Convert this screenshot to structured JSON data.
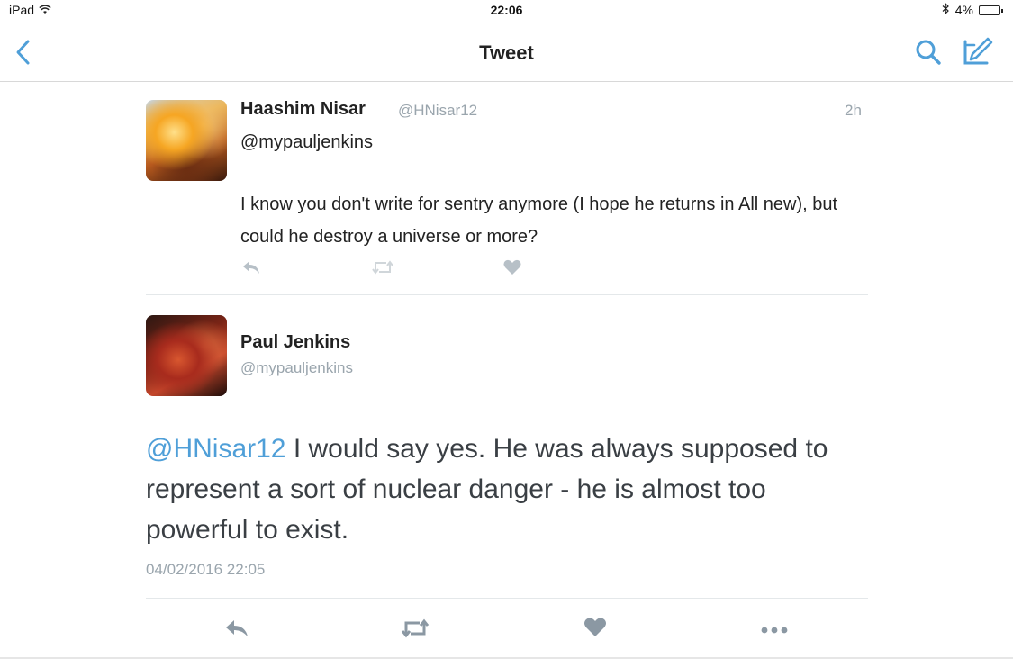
{
  "status_bar": {
    "device": "iPad",
    "time": "22:06",
    "battery": "4%"
  },
  "nav": {
    "title": "Tweet"
  },
  "tweet_parent": {
    "author_name": "Haashim Nisar",
    "author_handle": "@HNisar12",
    "time_ago": "2h",
    "reply_to": "@mypauljenkins",
    "body": "I know you don't write for sentry anymore (I hope he returns in All new), but could he destroy a universe or more?"
  },
  "tweet_main": {
    "author_name": "Paul Jenkins",
    "author_handle": "@mypauljenkins",
    "mention": "@HNisar12",
    "body": " I would say yes. He was always supposed to represent a sort of nuclear danger - he is almost too powerful to exist.",
    "timestamp": "04/02/2016 22:05"
  },
  "colors": {
    "accent_blue": "#4f9fd8",
    "muted_gray": "#9aa5ad"
  }
}
